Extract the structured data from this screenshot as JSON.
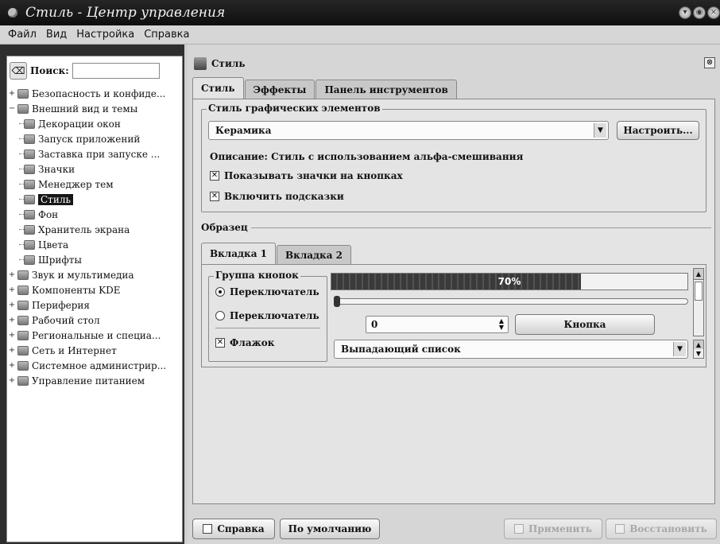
{
  "window": {
    "title": "Стиль - Центр управления"
  },
  "menubar": {
    "items": [
      "Файл",
      "Вид",
      "Настройка",
      "Справка"
    ]
  },
  "sidebar": {
    "search_label": "Поиск:",
    "search_value": "",
    "items": [
      {
        "label": "Безопасность и конфиде...",
        "expander": "+",
        "icon": "shield-icon",
        "level": 0
      },
      {
        "label": "Внешний вид и темы",
        "expander": "−",
        "icon": "appearance-icon",
        "level": 0
      },
      {
        "label": "Декорации окон",
        "icon": "window-decoration-icon",
        "level": 1
      },
      {
        "label": "Запуск приложений",
        "icon": "launch-icon",
        "level": 1
      },
      {
        "label": "Заставка при запуске ...",
        "icon": "splash-icon",
        "level": 1
      },
      {
        "label": "Значки",
        "icon": "icons-icon",
        "level": 1
      },
      {
        "label": "Менеджер тем",
        "icon": "theme-manager-icon",
        "level": 1
      },
      {
        "label": "Стиль",
        "icon": "style-icon",
        "level": 1,
        "selected": true
      },
      {
        "label": "Фон",
        "icon": "background-icon",
        "level": 1
      },
      {
        "label": "Хранитель экрана",
        "icon": "screensaver-icon",
        "level": 1
      },
      {
        "label": "Цвета",
        "icon": "colors-icon",
        "level": 1
      },
      {
        "label": "Шрифты",
        "icon": "fonts-icon",
        "level": 1
      },
      {
        "label": "Звук и мультимедиа",
        "expander": "+",
        "icon": "sound-icon",
        "level": 0
      },
      {
        "label": "Компоненты KDE",
        "expander": "+",
        "icon": "kde-components-icon",
        "level": 0
      },
      {
        "label": "Периферия",
        "expander": "+",
        "icon": "peripherals-icon",
        "level": 0
      },
      {
        "label": "Рабочий стол",
        "expander": "+",
        "icon": "desktop-icon",
        "level": 0
      },
      {
        "label": "Региональные и специа...",
        "expander": "+",
        "icon": "regional-icon",
        "level": 0
      },
      {
        "label": "Сеть и Интернет",
        "expander": "+",
        "icon": "network-icon",
        "level": 0
      },
      {
        "label": "Системное администрир...",
        "expander": "+",
        "icon": "sysadmin-icon",
        "level": 0
      },
      {
        "label": "Управление питанием",
        "expander": "+",
        "icon": "power-icon",
        "level": 0
      }
    ]
  },
  "module": {
    "title": "Стиль",
    "tabs": [
      "Стиль",
      "Эффекты",
      "Панель инструментов"
    ],
    "active_tab": 0,
    "widget_style": {
      "group_title": "Стиль графических элементов",
      "selected_style": "Керамика",
      "configure_button": "Настроить...",
      "description": "Описание: Стиль с использованием альфа-смешивания",
      "show_icons_on_buttons": {
        "label": "Показывать значки на кнопках",
        "checked": true
      },
      "enable_tooltips": {
        "label": "Включить подсказки",
        "checked": true
      }
    },
    "preview": {
      "title": "Образец",
      "tabs": [
        "Вкладка 1",
        "Вкладка 2"
      ],
      "button_group": "Группа кнопок",
      "radio1": {
        "label": "Переключатель",
        "checked": true
      },
      "radio2": {
        "label": "Переключатель",
        "checked": false
      },
      "checkbox": {
        "label": "Флажок",
        "checked": true
      },
      "progress_text": "70%",
      "progress": 0.7,
      "slider": 0,
      "spin_value": "0",
      "push_button": "Кнопка",
      "combo_text": "Выпадающий список"
    }
  },
  "footer": {
    "help": "Справка",
    "defaults": "По умолчанию",
    "apply": "Применить",
    "reset": "Восстановить"
  }
}
